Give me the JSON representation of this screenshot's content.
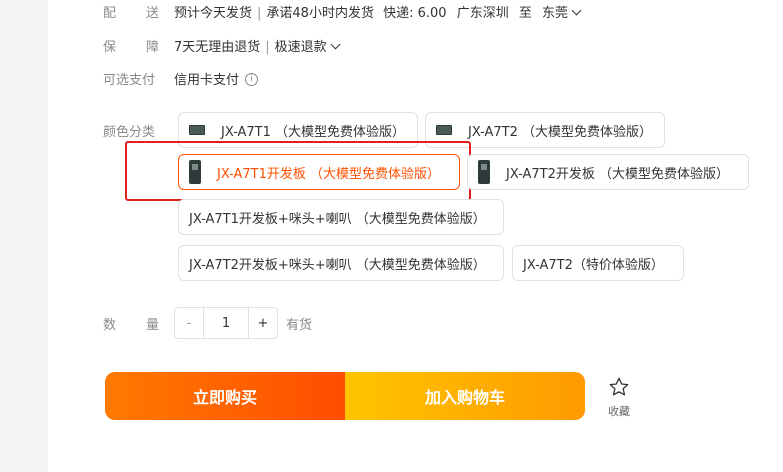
{
  "delivery": {
    "label": "配送",
    "estimate": "预计今天发货",
    "promise": "承诺48小时内发货",
    "fee": "快递: 6.00",
    "from": "广东深圳",
    "to_word": "至",
    "destination": "东莞"
  },
  "guarantee": {
    "label": "保障",
    "item1": "7天无理由退货",
    "item2": "极速退款"
  },
  "payment": {
    "label": "可选支付",
    "method": "信用卡支付",
    "info_icon": "info-icon"
  },
  "color": {
    "label": "颜色分类",
    "options": [
      "JX-A7T1 （大模型免费体验版）",
      "JX-A7T2 （大模型免费体验版）",
      "JX-A7T1开发板 （大模型免费体验版）",
      "JX-A7T2开发板 （大模型免费体验版）",
      "JX-A7T1开发板+咪头+喇叭 （大模型免费体验版）",
      "JX-A7T2开发板+咪头+喇叭 （大模型免费体验版）",
      "JX-A7T2（特价体验版）"
    ],
    "selected": "JX-A7T1开发板 （大模型免费体验版）",
    "selected_color": "#ff5000",
    "highlight_color": "#e0201c"
  },
  "quantity": {
    "label": "数量",
    "minus": "-",
    "value": "1",
    "plus": "+",
    "stock": "有货"
  },
  "actions": {
    "buy": "立即购买",
    "cart": "加入购物车",
    "favorite": "收藏",
    "favorite_icon": "star-icon"
  }
}
